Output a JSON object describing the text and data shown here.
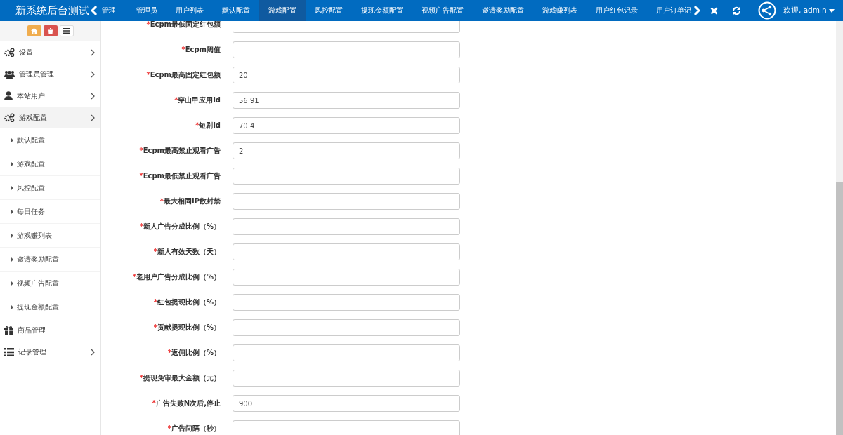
{
  "brand": "新系统后台测试",
  "tabs": [
    {
      "label": "管理",
      "selected": false
    },
    {
      "label": "管理员",
      "selected": false
    },
    {
      "label": "用户列表",
      "selected": false
    },
    {
      "label": "默认配置",
      "selected": false
    },
    {
      "label": "游戏配置",
      "selected": true
    },
    {
      "label": "风控配置",
      "selected": false
    },
    {
      "label": "提现金额配置",
      "selected": false
    },
    {
      "label": "视频广告配置",
      "selected": false
    },
    {
      "label": "邀请奖励配置",
      "selected": false
    },
    {
      "label": "游戏赚列表",
      "selected": false
    },
    {
      "label": "用户红包记录",
      "selected": false
    },
    {
      "label": "用户订单记",
      "selected": false
    }
  ],
  "user": {
    "greeting": "欢迎,",
    "name": "admin"
  },
  "sidebar": {
    "items": [
      {
        "label": "设置",
        "kind": "group",
        "selected": false
      },
      {
        "label": "管理员管理",
        "kind": "group",
        "selected": false
      },
      {
        "label": "本站用户",
        "kind": "group",
        "selected": false
      },
      {
        "label": "游戏配置",
        "kind": "group",
        "selected": true,
        "children": [
          {
            "label": "默认配置"
          },
          {
            "label": "游戏配置"
          },
          {
            "label": "风控配置"
          },
          {
            "label": "每日任务"
          },
          {
            "label": "游戏赚列表"
          },
          {
            "label": "邀请奖励配置"
          },
          {
            "label": "视频广告配置"
          },
          {
            "label": "提现金额配置"
          }
        ]
      },
      {
        "label": "商品管理",
        "kind": "link",
        "selected": false
      },
      {
        "label": "记录管理",
        "kind": "group",
        "selected": false
      }
    ]
  },
  "form": {
    "fields": [
      {
        "mark": "*",
        "label": "Ecpm最低固定红包额"
      },
      {
        "mark": "*",
        "label": "Ecpm阈值"
      },
      {
        "mark": "*",
        "label": "Ecpm最高固定红包额",
        "value": "20"
      },
      {
        "mark": "*",
        "label": "穿山甲应用id",
        "value": "56 91"
      },
      {
        "mark": "*",
        "label": "短剧id",
        "value": "70 4"
      },
      {
        "mark": "*",
        "label": "Ecpm最高禁止观看广告",
        "value": "2"
      },
      {
        "mark": "*",
        "label": "Ecpm最低禁止观看广告"
      },
      {
        "mark": "*",
        "label": "最大相同IP数封禁"
      },
      {
        "mark": "*",
        "label": "新人广告分成比例（%）"
      },
      {
        "mark": "*",
        "label": "新人有效天数（天）"
      },
      {
        "mark": "*",
        "label": "老用户广告分成比例（%）"
      },
      {
        "mark": "*",
        "label": "红包提现比例（%）"
      },
      {
        "mark": "*",
        "label": "贡献提现比例（%）"
      },
      {
        "mark": "*",
        "label": "返佣比例（%）"
      },
      {
        "mark": "*",
        "label": "提现免审最大金额（元）"
      },
      {
        "mark": "*",
        "label": "广告失败N次后,停止",
        "value": "900"
      },
      {
        "mark": "*",
        "label": "广告间隔（秒）"
      }
    ]
  }
}
